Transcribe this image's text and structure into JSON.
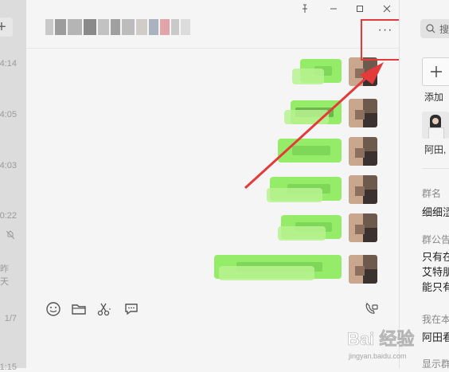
{
  "left_list": {
    "add_label": "+",
    "times": [
      "4:14",
      "4:05",
      "4:03",
      "0:22",
      "昨天",
      "1/7",
      "1:15"
    ]
  },
  "window_controls": {
    "pin": "⊥",
    "minimize": "—",
    "maximize": "☐",
    "close": "✕"
  },
  "chat": {
    "more_label": "···",
    "messages_count_visible": 6
  },
  "toolbar": {
    "icons": [
      "emoji-icon",
      "folder-icon",
      "scissors-icon",
      "chat-bubble-icon",
      "video-call-icon"
    ]
  },
  "right_panel": {
    "search_placeholder": "搜",
    "add_label": "添加",
    "member_name": "阿田,",
    "group_name_label": "群名",
    "group_name_value": "细细涩",
    "announcement_label": "群公告",
    "announcement_lines": [
      "只有在",
      "艾特朋",
      "能只有"
    ],
    "my_alias_label": "我在本",
    "my_alias_value": "阿田看",
    "show_label": "显示群"
  },
  "watermark": {
    "main": "Bai 经验",
    "sub": "jingyan.baidu.com"
  },
  "colors": {
    "bubble": "#95ec69",
    "highlight": "#e53a3a",
    "background": "#f5f5f5"
  }
}
